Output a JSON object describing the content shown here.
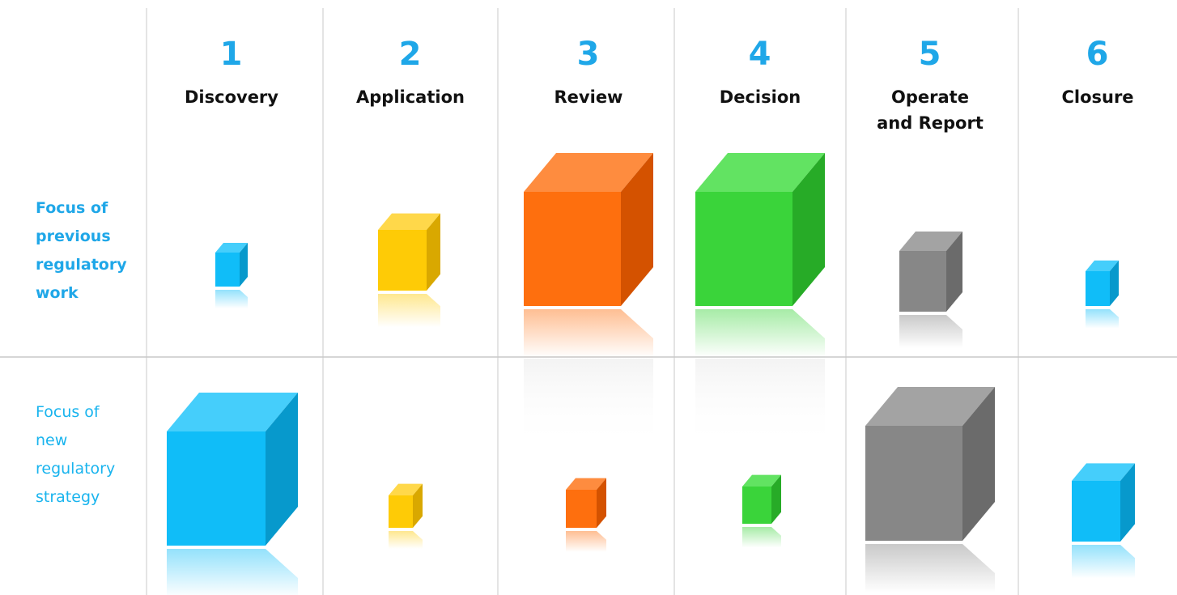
{
  "stages": [
    {
      "number": "1",
      "name": "Discovery"
    },
    {
      "number": "2",
      "name": "Application"
    },
    {
      "number": "3",
      "name": "Review"
    },
    {
      "number": "4",
      "name": "Decision"
    },
    {
      "number": "5",
      "name": "Operate\nand Report"
    },
    {
      "number": "6",
      "name": "Closure"
    }
  ],
  "rows": [
    {
      "label": "Focus of\nprevious\nregulatory\nwork"
    },
    {
      "label": "Focus of\nnew\nregulatory\nstrategy"
    }
  ],
  "colors": {
    "blue": {
      "front": "#10bdf8",
      "top": "#45cefb",
      "side": "#0799cc"
    },
    "yellow": {
      "front": "#fecb06",
      "top": "#ffd84a",
      "side": "#d9a800"
    },
    "orange": {
      "front": "#fe6f0e",
      "top": "#fe8c3f",
      "side": "#d45200"
    },
    "green": {
      "front": "#3ad43a",
      "top": "#62e362",
      "side": "#27ab27"
    },
    "gray": {
      "front": "#878787",
      "top": "#a3a3a3",
      "side": "#6b6b6b"
    },
    "grid": "#c8c8c8"
  },
  "cubes": [
    {
      "row": 0,
      "stage": 0,
      "color": "blue"
    },
    {
      "row": 0,
      "stage": 1,
      "color": "yellow"
    },
    {
      "row": 0,
      "stage": 2,
      "color": "orange"
    },
    {
      "row": 0,
      "stage": 3,
      "color": "green"
    },
    {
      "row": 0,
      "stage": 4,
      "color": "gray"
    },
    {
      "row": 0,
      "stage": 5,
      "color": "blue"
    },
    {
      "row": 1,
      "stage": 0,
      "color": "blue"
    },
    {
      "row": 1,
      "stage": 1,
      "color": "yellow"
    },
    {
      "row": 1,
      "stage": 2,
      "color": "orange"
    },
    {
      "row": 1,
      "stage": 3,
      "color": "green"
    },
    {
      "row": 1,
      "stage": 4,
      "color": "gray"
    },
    {
      "row": 1,
      "stage": 5,
      "color": "blue"
    }
  ]
}
